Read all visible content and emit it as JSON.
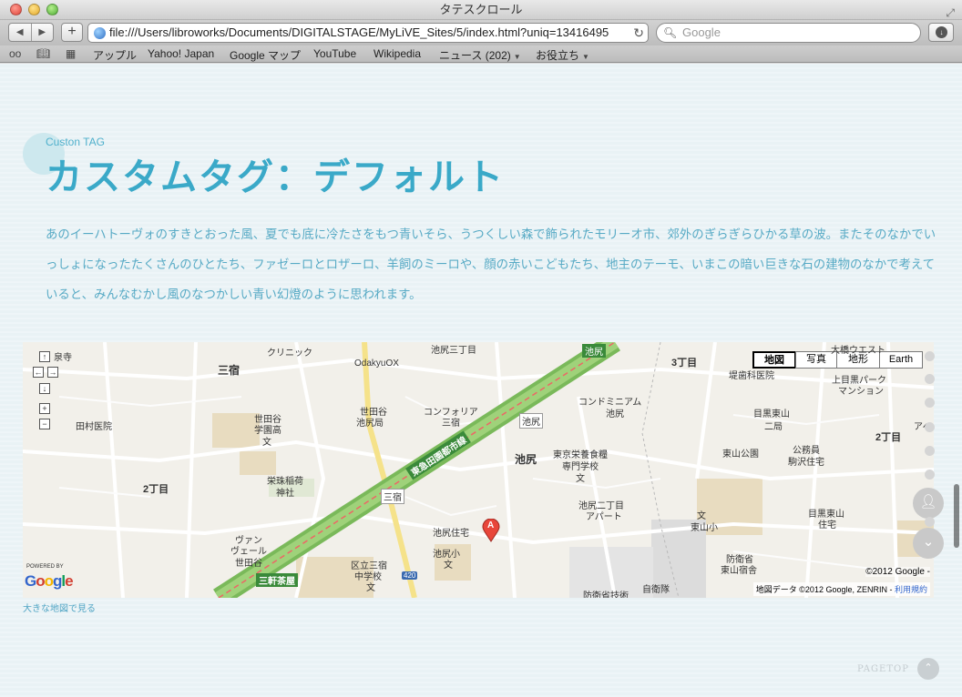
{
  "window": {
    "title": "タテスクロール"
  },
  "toolbar": {
    "back_icon": "◀",
    "forward_icon": "▶",
    "add_icon": "+",
    "url": "file:///Users/libroworks/Documents/DIGITALSTAGE/MyLiVE_Sites/5/index.html?uniq=13416495",
    "reload_icon": "↻",
    "search_placeholder": "Google",
    "search_icon": "🔍︎",
    "download_icon": "↓"
  },
  "bookmarks": {
    "reading_list_icon": "oo",
    "book_icon": "📖︎",
    "grid_icon": "▦",
    "items": [
      "アップル",
      "Yahoo! Japan",
      "Google マップ",
      "YouTube",
      "Wikipedia",
      "ニュース (202)",
      "お役立ち"
    ]
  },
  "content": {
    "custom_tag": "Custon TAG",
    "title": "カスタムタグ：デフォルト",
    "paragraph": "あのイーハトーヴォのすきとおった風、夏でも底に冷たさをもつ青いそら、うつくしい森で飾られたモリーオ市、郊外のぎらぎらひかる草の波。またそのなかでいっしょになったたくさんのひとたち、ファゼーロとロザーロ、羊飼のミーロや、顔の赤いこどもたち、地主のテーモ、いまこの暗い巨きな石の建物のなかで考えていると、みんなむかし風のなつかしい青い幻燈のように思われます。"
  },
  "map": {
    "types": [
      "地図",
      "写真",
      "地形",
      "Earth"
    ],
    "active_type": "地図",
    "labels": {
      "l1": "泉寺",
      "l2": "クリニック",
      "l3": "OdakyuOX",
      "l4": "池尻三丁目",
      "l5": "池尻",
      "l6": "3丁目",
      "l7": "大橋ウエスト",
      "l8": "堤歯科医院",
      "l9": "上目黒パーク",
      "l10": "マンション",
      "l11": "三宿",
      "l12": "田村医院",
      "l13": "世田谷",
      "l14": "学園高",
      "l15": "文",
      "l16": "世田谷",
      "l17": "池尻局",
      "l18": "コンフォリア",
      "l19": "三宿",
      "l20": "池尻",
      "l21": "コンドミニアム",
      "l22": "池尻",
      "l23": "目黒東山",
      "l24": "二局",
      "l25": "アペ",
      "l26": "2丁目",
      "l27": "東山公園",
      "l28": "公務員",
      "l29": "駒沢住宅",
      "l30": "東急田園都市線",
      "l31": "池尻",
      "l32": "東京栄養食糧",
      "l33": "専門学校",
      "l34": "文",
      "l35": "栄珠稲荷",
      "l36": "神社",
      "l37": "2丁目",
      "l38": "三宿",
      "l39": "池尻二丁目",
      "l40": "アパート",
      "l41": "目黒東山",
      "l42": "住宅",
      "l43": "東山小",
      "l44": "文",
      "l45": "池尻住宅",
      "l46": "池尻小",
      "l47": "文",
      "l48": "ヴァン",
      "l49": "ヴェール",
      "l50": "世田谷",
      "l51": "区立三宿",
      "l52": "中学校",
      "l53": "文",
      "l54": "防衛省",
      "l55": "東山宿舎",
      "l56": "三軒茶屋",
      "l57": "420",
      "l58": "防衛省技術",
      "l59": "自衛隊"
    },
    "marker_label": "A",
    "powered_by": "POWERED BY",
    "google_logo": "Google",
    "copyright": "©2012 Google -",
    "data_credit": "地図データ ©2012 Google, ZENRIN - ",
    "terms_link": "利用規約",
    "large_map_link": "大きな地図で見る",
    "zoom_in": "+",
    "zoom_out": "−",
    "pan_up": "↑",
    "pan_down": "↓",
    "pan_left": "←",
    "pan_right": "→"
  },
  "side": {
    "profile_icon": "👤︎",
    "down_icon": "⌄"
  },
  "footer": {
    "pagetop": "PAGETOP",
    "pagetop_icon": "⌃"
  }
}
